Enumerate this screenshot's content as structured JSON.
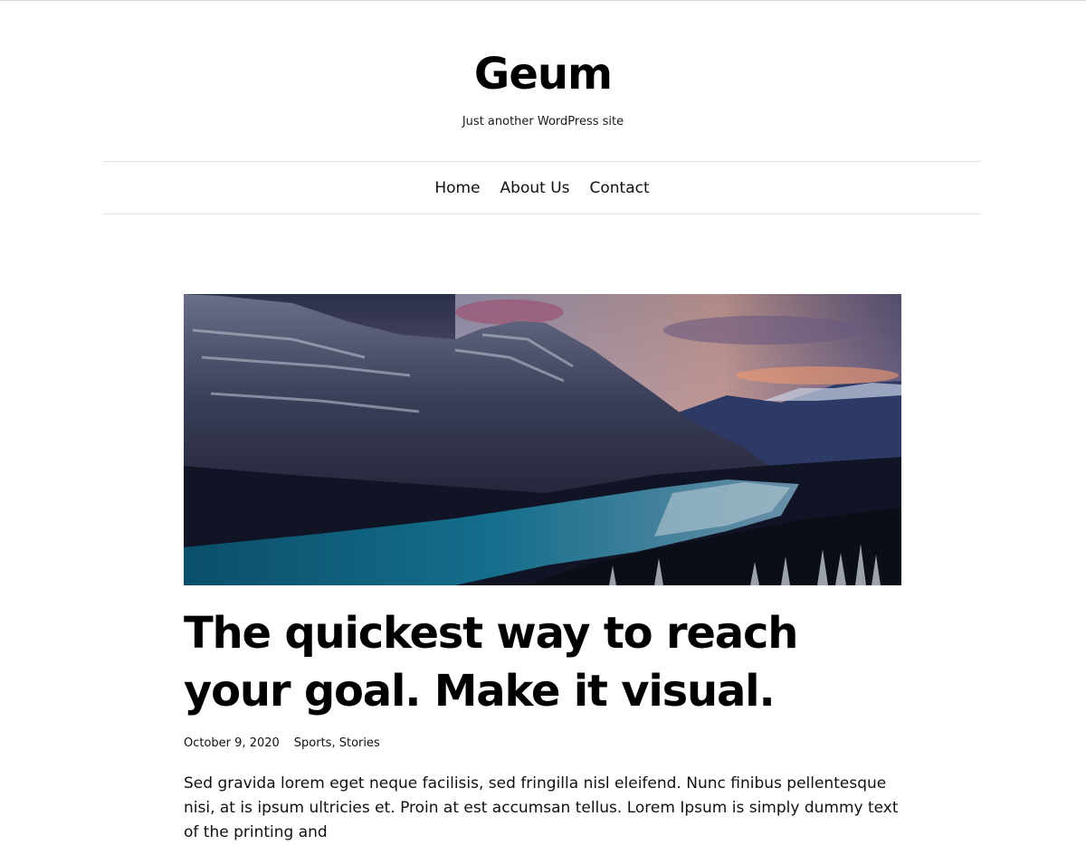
{
  "site": {
    "title": "Geum",
    "tagline": "Just another WordPress site"
  },
  "nav": {
    "items": [
      {
        "label": "Home"
      },
      {
        "label": "About Us"
      },
      {
        "label": "Contact"
      }
    ]
  },
  "post": {
    "image_subject": "mountain-lake-landscape-photo",
    "title": "The quickest way to reach your goal. Make it visual.",
    "date": "October 9, 2020",
    "categories": [
      "Sports",
      "Stories"
    ],
    "category_separator": ", ",
    "excerpt": "Sed gravida lorem eget neque facilisis, sed fringilla nisl eleifend. Nunc finibus pellentesque nisi, at is ipsum ultricies et. Proin at est accumsan tellus. Lorem Ipsum is simply dummy text of the printing and"
  },
  "colors": {
    "background": "#ffffff",
    "text": "#000000",
    "rule": "#e2e2e2"
  }
}
